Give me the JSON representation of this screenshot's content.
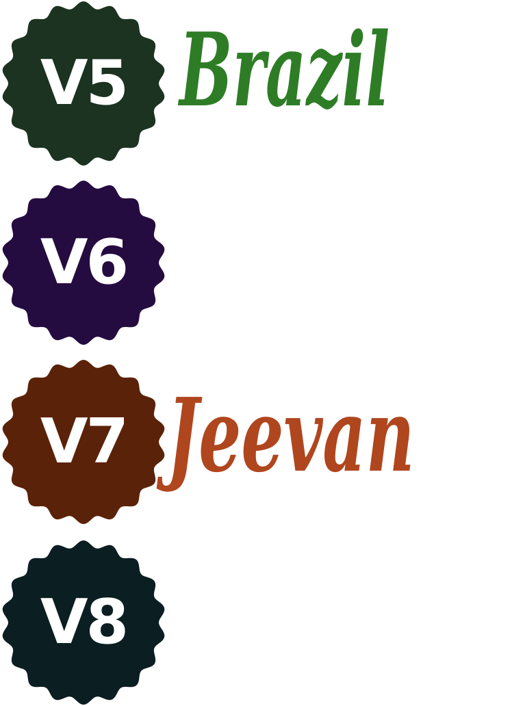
{
  "items": [
    {
      "badge": "V5",
      "name": "Brazil",
      "badge_color": "#1b3320",
      "name_color": "#2e7d26"
    },
    {
      "badge": "V6",
      "name": "",
      "badge_color": "#250c40",
      "name_color": ""
    },
    {
      "badge": "V7",
      "name": "Jeevan",
      "badge_color": "#5a2208",
      "name_color": "#b0461e"
    },
    {
      "badge": "V8",
      "name": "",
      "badge_color": "#0b1e22",
      "name_color": ""
    }
  ]
}
